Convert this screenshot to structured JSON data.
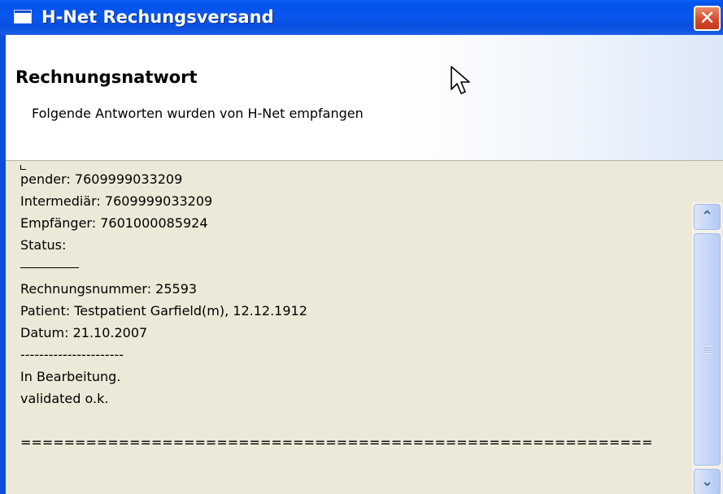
{
  "window": {
    "title": "H-Net Rechungsversand",
    "close_glyph": "✕"
  },
  "header": {
    "title": "Rechnungsnatwort",
    "subtitle": "Folgende Antworten wurden von H-Net empfangen"
  },
  "response": {
    "sender": "pender: 7609999033209",
    "intermediar": "Intermediär: 7609999033209",
    "empfaenger": "Empfänger: 7601000085924",
    "status": "Status:",
    "rechnungsnummer": "Rechnungsnummer: 25593",
    "patient": "Patient: Testpatient Garfield(m), 12.12.1912",
    "datum": "Datum: 21.10.2007",
    "dashes": "----------------------",
    "bearbeitung": "In Bearbeitung.",
    "validated": "validated o.k.",
    "double_rule": "=========================================================="
  },
  "scrollbar": {
    "up_glyph": "⌃",
    "down_glyph": "⌄"
  },
  "icons": {
    "window": "window-icon",
    "close": "close-icon",
    "cursor": "mouse-pointer-icon"
  }
}
